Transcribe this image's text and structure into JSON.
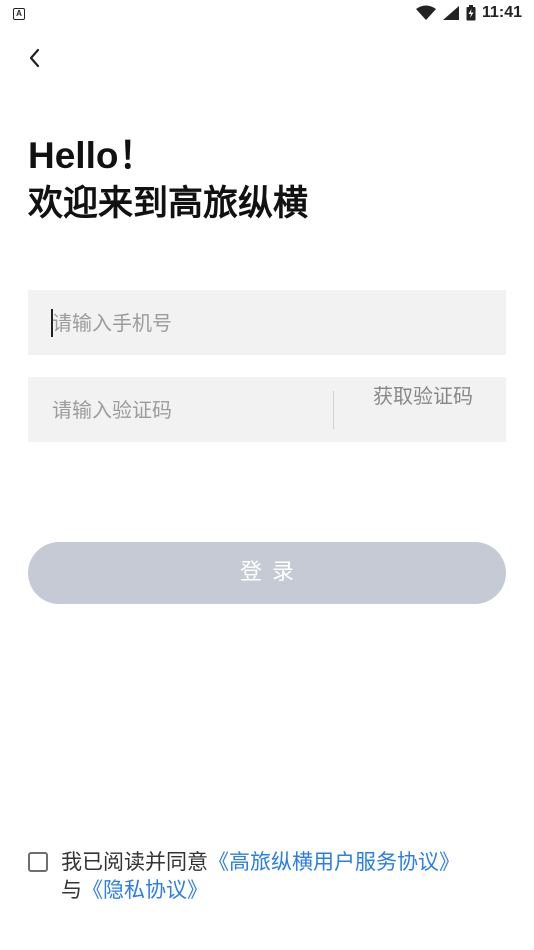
{
  "status_bar": {
    "left_icon": "A",
    "time": "11:41",
    "icons": [
      "wifi-icon",
      "signal-icon",
      "battery-icon"
    ]
  },
  "greeting": {
    "line1": "Hello！",
    "line2": "欢迎来到高旅纵横"
  },
  "phone_input": {
    "placeholder": "请输入手机号",
    "value": ""
  },
  "code_input": {
    "placeholder": "请输入验证码",
    "value": ""
  },
  "get_code_button": {
    "label": "获取验证码"
  },
  "login_button": {
    "label": "登录"
  },
  "agreement": {
    "checked": false,
    "prefix": "我已阅读并同意",
    "user_agreement_link": "《高旅纵横用户服务协议》",
    "conjunction": "与",
    "privacy_link": "《隐私协议》"
  },
  "colors": {
    "input_background": "#f2f2f2",
    "login_button_disabled": "#c6cad4",
    "link": "#2b7de9",
    "placeholder": "#9c9c9c"
  }
}
